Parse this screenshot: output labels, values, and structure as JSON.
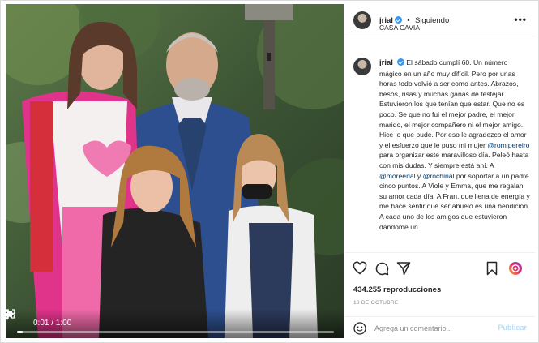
{
  "video": {
    "time": "0:01 / 1:00",
    "progress": 0.017
  },
  "post": {
    "username": "jrial",
    "follow_status": "Siguiendo",
    "location": "CASA CAVIA",
    "caption": {
      "t1": "El sábado cumplí 60. Un número mágico en un año muy difícil. Pero por unas horas todo volvió a ser como antes. Abrazos, besos, risas y muchas ganas de festejar. Estuvieron los que tenían que estar. Que no es poco. Se que no fui el mejor padre, el mejor marido, el mejor compañero ni el mejor amigo. Hice lo que pude. Por eso le agradezco el amor y el esfuerzo que le puso mi mujer ",
      "m1": "@romipereiro",
      "t2": " para organizar este maravilloso día. Peleó hasta con mis dudas. Y siempre está ahí. A ",
      "m2": "@moreerial",
      "t3": " y ",
      "m3": "@rochirial",
      "t4": " por soportar a un padre cinco puntos. A Viole y Emma, que me regalan su amor cada día. A Fran, que llena de energía y me hace sentir que ser abuelo es una bendición. A cada uno de los amigos que estuvieron dándome un"
    },
    "views": "434.255 reproducciones",
    "date": "18 DE OCTUBRE",
    "comment_placeholder": "Agrega un comentario...",
    "publish_label": "Publicar"
  },
  "icons": {
    "like": "heart-icon",
    "comment": "comment-icon",
    "share": "share-icon",
    "save": "bookmark-icon",
    "emoji": "emoji-icon",
    "more": "more-icon"
  },
  "colors": {
    "verified": "#3897f0",
    "mention": "#00376b",
    "publish": "#b2dffc"
  }
}
